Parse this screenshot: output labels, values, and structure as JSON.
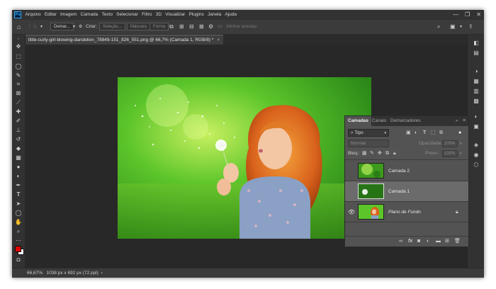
{
  "menubar": {
    "logo": "Ps",
    "items": [
      "Arquivo",
      "Editar",
      "Imagem",
      "Camada",
      "Texto",
      "Selecionar",
      "Filtro",
      "3D",
      "Visualizar",
      "Plugins",
      "Janela",
      "Ajuda"
    ],
    "window_controls": [
      "—",
      "❐",
      "✕"
    ]
  },
  "options_bar": {
    "home_icon": "home-icon",
    "preset": "Demar...",
    "criar_label": "Criar:",
    "selecao_label": "Seleção...",
    "mascara_label": "Máscara",
    "forma_label": "Forma",
    "alinhar_label": "Alinhar arestas"
  },
  "document": {
    "tab_title": "little-curly-girl-blowing-dandelion_78849-151_826_551.png @ 66,7% (Camada 1, RGB/8) *",
    "close": "×"
  },
  "status": {
    "zoom": "66,67%",
    "size": "1038 px x 692 px (72 ppi)"
  },
  "tools": [
    "move-tool-icon",
    "marquee-tool-icon",
    "lasso-tool-icon",
    "quick-select-icon",
    "crop-tool-icon",
    "frame-tool-icon",
    "eyedropper-icon",
    "healing-brush-icon",
    "brush-tool-icon",
    "clone-stamp-icon",
    "history-brush-icon",
    "eraser-icon",
    "gradient-tool-icon",
    "blur-tool-icon",
    "dodge-tool-icon",
    "pen-tool-icon",
    "type-tool-icon",
    "path-select-icon",
    "ellipse-tool-icon",
    "hand-tool-icon",
    "zoom-tool-icon",
    "more-tools-icon"
  ],
  "colors": {
    "foreground": "#e00000",
    "background": "#ffffff"
  },
  "layers_panel": {
    "tabs": [
      "Camadas",
      "Canais",
      "Demarcadores"
    ],
    "filter_label": "Tipo",
    "blend_mode": "Normal",
    "opacity_label": "Opacidade:",
    "opacity_value": "100%",
    "lock_label": "Bloq.:",
    "fill_label": "Preen.:",
    "fill_value": "100%",
    "layers": [
      {
        "name": "Camada 2",
        "visible": false,
        "selected": false
      },
      {
        "name": "Camada 1",
        "visible": false,
        "selected": true
      },
      {
        "name": "Plano de Fundo",
        "visible": true,
        "selected": false,
        "locked": true
      }
    ]
  }
}
